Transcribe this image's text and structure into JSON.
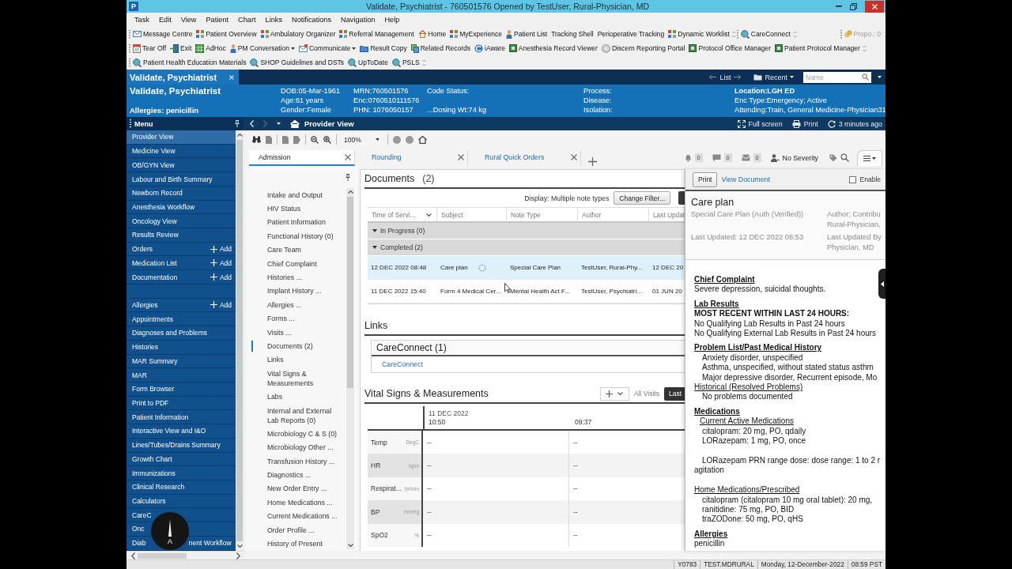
{
  "window": {
    "app_letter": "P",
    "title": "Validate, Psychiatrist - 760501576 Opened by TestUser, Rural-Physician, MD"
  },
  "menu_bar": [
    "Task",
    "Edit",
    "View",
    "Patient",
    "Chart",
    "Links",
    "Notifications",
    "Navigation",
    "Help"
  ],
  "toolbars": [
    {
      "groups": [
        [
          {
            "kind": "mail",
            "label": "Message Centre"
          },
          {
            "kind": "grid",
            "label": "Patient Overview"
          },
          {
            "kind": "grid",
            "label": "Ambulatory Organizer"
          },
          {
            "kind": "grid",
            "label": "Referral Management"
          },
          {
            "kind": "house",
            "label": "Home"
          },
          {
            "kind": "grid",
            "label": "MyExperience"
          },
          {
            "kind": "person",
            "label": "Patient List"
          },
          {
            "kind": "text",
            "label": "Tracking Shell"
          },
          {
            "kind": "text",
            "label": "Perioperative Tracking"
          },
          {
            "kind": "grid",
            "label": "Dynamic Worklist"
          }
        ],
        [
          {
            "kind": "globe",
            "label": "CareConnect"
          }
        ]
      ],
      "counter": {
        "label": "Propo.: 0",
        "disabled": true
      }
    },
    {
      "groups": [
        [
          {
            "kind": "tearoff",
            "label": "Tear Off",
            "dropdown": false
          },
          {
            "kind": "exit",
            "label": "Exit",
            "dropdown": false
          },
          {
            "kind": "sheet",
            "label": "AdHoc",
            "dropdown": false
          },
          {
            "kind": "person",
            "label": "PM Conversation",
            "dropdown": true
          },
          {
            "kind": "envelope",
            "label": "Communicate",
            "dropdown": true
          },
          {
            "kind": "folder",
            "label": "Result Copy",
            "dropdown": false
          },
          {
            "kind": "stack",
            "label": "Related Records",
            "dropdown": false
          },
          {
            "kind": "ring",
            "label": "iAware",
            "dropdown": false
          },
          {
            "kind": "tile",
            "label": "Anesthesia Record Viewer",
            "dropdown": false
          },
          {
            "kind": "disc",
            "label": "Discern Reporting Portal",
            "dropdown": false
          },
          {
            "kind": "tile",
            "label": "Protocol Office Manager",
            "dropdown": false
          },
          {
            "kind": "tile",
            "label": "Patient Protocol Manager",
            "dropdown": false
          }
        ]
      ]
    },
    {
      "groups": [
        [
          {
            "kind": "globe",
            "label": "Patient Health Education Materials"
          },
          {
            "kind": "globe",
            "label": "SHOP Guidelines and DSTs"
          },
          {
            "kind": "globe",
            "label": "UpToDate"
          },
          {
            "kind": "globe",
            "label": "PSLS"
          }
        ]
      ]
    }
  ],
  "patient_tabs": [
    {
      "label": "Validate, Psychiatrist",
      "selected": true
    }
  ],
  "patient_nav": {
    "list": "List",
    "recent": "Recent",
    "search": {
      "placeholder": "Name"
    }
  },
  "banner": {
    "name": "Validate, Psychiatrist",
    "allergies": "Allergies: penicillin",
    "columns": [
      {
        "top": "DOB:05-Mar-1961",
        "middle": "Age:61 years",
        "bottom": "Gender:Female",
        "bold_top": false
      },
      {
        "top": "MRN:760501576",
        "middle": "Enc:0760510111576",
        "bottom": "PHN: 1076050157",
        "bold_top": false
      },
      {
        "top": "Code Status:",
        "bottom": "...Dosing Wt:74 kg",
        "bold_top": false
      },
      {
        "top": "Process:",
        "middle": "Disease:",
        "bottom": "Isolation:",
        "bold_top": false
      },
      {
        "top": "Location:LGH ED",
        "middle": "Enc Type:Emergency; Active",
        "bottom": "Attending:Train, General Medicine-Physician31",
        "bold_top": true
      }
    ]
  },
  "view_nav": {
    "title": "Provider View",
    "forward_disabled": true,
    "actions": [
      {
        "kind": "fullscreen",
        "label": "Full screen"
      },
      {
        "kind": "print",
        "label": "Print"
      },
      {
        "kind": "refresh",
        "label": "3 minutes ago"
      }
    ]
  },
  "menu": {
    "title": "Menu",
    "items": [
      {
        "kind": "link",
        "label": "Provider View",
        "selected": true
      },
      {
        "kind": "link",
        "label": "Medicine View",
        "selected": false
      },
      {
        "kind": "link",
        "label": "OB/GYN View",
        "selected": false
      },
      {
        "kind": "link",
        "label": "Labour and Birth Summary",
        "selected": false
      },
      {
        "kind": "link",
        "label": "Newborn Record",
        "selected": false
      },
      {
        "kind": "link",
        "label": "Anesthesia Workflow",
        "selected": false
      },
      {
        "kind": "link",
        "label": "Oncology View",
        "selected": false
      },
      {
        "kind": "link",
        "label": "Results Review",
        "selected": false
      },
      {
        "kind": "add",
        "label": "Orders",
        "action": "Add",
        "selected": false
      },
      {
        "kind": "add",
        "label": "Medication List",
        "action": "Add",
        "selected": false
      },
      {
        "kind": "add",
        "label": "Documentation",
        "action": "Add",
        "selected": false
      },
      {
        "kind": "blank"
      },
      {
        "kind": "add",
        "label": "Allergies",
        "action": "Add",
        "selected": false
      },
      {
        "kind": "link",
        "label": "Appointments",
        "selected": false
      },
      {
        "kind": "link",
        "label": "Diagnoses and Problems",
        "selected": false
      },
      {
        "kind": "link",
        "label": "Histories",
        "selected": false
      },
      {
        "kind": "link",
        "label": "MAR Summary",
        "selected": false
      },
      {
        "kind": "link",
        "label": "MAR",
        "selected": false
      },
      {
        "kind": "link",
        "label": "Form Browser",
        "selected": false
      },
      {
        "kind": "link",
        "label": "Print to PDF",
        "selected": false
      },
      {
        "kind": "link",
        "label": "Patient Information",
        "selected": false
      },
      {
        "kind": "link",
        "label": "Interactive View and I&O",
        "selected": false
      },
      {
        "kind": "link",
        "label": "Lines/Tubes/Drains Summary",
        "selected": false
      },
      {
        "kind": "link",
        "label": "Growth Chart",
        "selected": false
      },
      {
        "kind": "link",
        "label": "Immunizations",
        "selected": false
      },
      {
        "kind": "link",
        "label": "Clinical Research",
        "selected": false
      },
      {
        "kind": "link",
        "label": "Calculators",
        "selected": false
      },
      {
        "kind": "link",
        "label": "CareC",
        "selected": false
      },
      {
        "kind": "link",
        "label": "Onc",
        "selected": false
      },
      {
        "kind": "split",
        "parts": [
          "Diab",
          "nent Workflow"
        ],
        "selected": false
      }
    ],
    "overlay": {
      "letter": "A"
    }
  },
  "chart_toolbar": {
    "zoom": "100%"
  },
  "view_tabs": [
    {
      "label": "Admission",
      "selected": true
    },
    {
      "label": "Rounding",
      "selected": false
    },
    {
      "label": "Rural Quick Orders",
      "selected": false
    }
  ],
  "indicators": [
    {
      "kind": "bell",
      "count": "0"
    },
    {
      "kind": "chat",
      "count": "0"
    },
    {
      "kind": "inbox",
      "count": "0"
    },
    {
      "kind": "person",
      "label": "No Severity"
    },
    {
      "kind": "tag"
    },
    {
      "kind": "search"
    }
  ],
  "section_nav": [
    {
      "label": "Intake and Output",
      "selected": false
    },
    {
      "label": "HIV Status",
      "selected": false
    },
    {
      "label": "Patient Information",
      "selected": false
    },
    {
      "label": "Functional History (0)",
      "selected": false
    },
    {
      "label": "Care Team",
      "selected": false
    },
    {
      "label": "Chief Complaint",
      "selected": false
    },
    {
      "label": "Histories ...",
      "selected": false
    },
    {
      "label": "Implant History ...",
      "selected": false
    },
    {
      "label": "Allergies ...",
      "selected": false
    },
    {
      "label": "Forms ...",
      "selected": false
    },
    {
      "label": "Visits ...",
      "selected": false
    },
    {
      "label": "Documents (2)",
      "selected": true
    },
    {
      "label": "Links",
      "selected": false
    },
    {
      "label": "Vital Signs & Measurements",
      "selected": false
    },
    {
      "label": "Labs",
      "selected": false
    },
    {
      "label": "Internal and External Lab Reports (0)",
      "selected": false
    },
    {
      "label": "Microbiology C & S (0)",
      "selected": false
    },
    {
      "label": "Microbiology Other ...",
      "selected": false
    },
    {
      "label": "Transfusion History ...",
      "selected": false
    },
    {
      "label": "Diagnostics ...",
      "selected": false
    },
    {
      "label": "New Order Entry ...",
      "selected": false
    },
    {
      "label": "Home Medications ...",
      "selected": false
    },
    {
      "label": "Current Medications ...",
      "selected": false
    },
    {
      "label": "Order Profile ...",
      "selected": false
    },
    {
      "label": "History of Present",
      "selected": false
    }
  ],
  "documents": {
    "title": "Documents",
    "count": "(2)",
    "display": "Display: Multiple note types",
    "filter_button": "Change Filter...",
    "columns": [
      "Time of Servi...",
      "Subject",
      "Note Type",
      "Author",
      "Last Updat"
    ],
    "groups": [
      {
        "label": "In Progress (0)",
        "expanded": true
      },
      {
        "label": "Completed (2)",
        "expanded": true,
        "rows": [
          {
            "cells": [
              "12 DEC 2022 08:48",
              "Care plan",
              "Special Care Plan",
              "TestUser, Rural-Phy...",
              "12 DEC 20"
            ],
            "selected": true,
            "busy": true
          },
          {
            "cells": [
              "11 DEC 2022 15:40",
              "Form 4 Medical Cer...",
              "Mental Health Act F...",
              "TestUser, Psychiatri...",
              "01 JUN 20"
            ],
            "selected": false,
            "busy": false
          }
        ]
      }
    ]
  },
  "links": {
    "title": "Links",
    "groups": [
      {
        "title": "CareConnect (1)",
        "items": [
          "CareConnect"
        ]
      }
    ]
  },
  "vitals": {
    "title": "Vital Signs & Measurements",
    "filter": "All Visits",
    "range_button": "Last",
    "date": "11 DEC 2022",
    "times": [
      "10:50",
      "09:37"
    ],
    "rows": [
      {
        "name": "Temp",
        "unit": "DegC",
        "values": [
          "--",
          "--"
        ]
      },
      {
        "name": "HR",
        "unit": "bpm",
        "values": [
          "--",
          "--"
        ]
      },
      {
        "name": "Respirat...",
        "unit": "br/min",
        "values": [
          "--",
          "--"
        ]
      },
      {
        "name": "BP",
        "unit": "mmHg",
        "values": [
          "--",
          "--"
        ]
      },
      {
        "name": "SpO2",
        "unit": "%",
        "values": [
          "--",
          "--"
        ]
      }
    ]
  },
  "document_view": {
    "print_button": "Print",
    "view_link": "View Document",
    "enable": {
      "label": "Enable",
      "checked": false
    },
    "title": "Care plan",
    "subtitle": "Special Care Plan (Auth (Verified))",
    "updated": "Last Updated: 12 DEC 2022 08:53",
    "author_lines": [
      "Author; Contribu",
      "Rural-Physician,"
    ],
    "updated_by_lines": [
      "Last Updated By",
      "Physician, MD"
    ],
    "sections": [
      {
        "heading": "Chief Complaint",
        "blocks": [
          [
            {
              "kind": "plain",
              "text": "Severe depression, suicidal thoughts."
            }
          ]
        ]
      },
      {
        "heading": "Lab Results",
        "blocks": [
          [
            {
              "kind": "bold",
              "text": "MOST RECENT WITHIN LAST 24 HOURS:"
            },
            {
              "kind": "plain",
              "text": "No Qualifying Lab Results in Past 24 hours"
            },
            {
              "kind": "plain",
              "text": "No Qualifying External Lab Results in Past 24 hours"
            }
          ]
        ]
      },
      {
        "heading": "Problem List/Past Medical History",
        "blocks": [
          [
            {
              "kind": "indent",
              "text": "Anxiety disorder, unspecified"
            },
            {
              "kind": "indent",
              "text": "Asthma, unspecified, without stated status asthm"
            },
            {
              "kind": "indent",
              "text": "Major depressive disorder, Recurrent episode, Mo"
            },
            {
              "kind": "subheading",
              "text": "Historical (Resolved Problems)"
            },
            {
              "kind": "indent",
              "text": "No problems documented"
            }
          ]
        ]
      },
      {
        "heading": "Medications",
        "blocks": [
          [
            {
              "kind": "subheading_indent",
              "text": "Current Active Medications"
            },
            {
              "kind": "indent",
              "text": "citalopram: 20 mg, PO, qdaily"
            },
            {
              "kind": "indent",
              "text": "LORazepam: 1 mg, PO, once"
            }
          ],
          [
            {
              "kind": "indent",
              "text": "LORazepam PRN range dose: dose range: 1 to 2 r"
            },
            {
              "kind": "plain",
              "text": "agitation"
            }
          ],
          [
            {
              "kind": "subheading",
              "text": "Home Medications/Prescribed"
            },
            {
              "kind": "indent",
              "text": "citalopram (citalopram 10 mg oral tablet): 20 mg,"
            },
            {
              "kind": "indent",
              "text": "ranitidine: 75 mg, PO, BID"
            },
            {
              "kind": "indent",
              "text": "traZODone: 50 mg, PO, qHS"
            }
          ]
        ]
      },
      {
        "heading": "Allergies",
        "blocks": [
          [
            {
              "kind": "plain",
              "text": "penicillin"
            }
          ]
        ]
      }
    ]
  },
  "status_bar": [
    "Y0783",
    "TEST.MDRURAL",
    "Monday, 12-December-2022",
    "08:59 PST"
  ]
}
